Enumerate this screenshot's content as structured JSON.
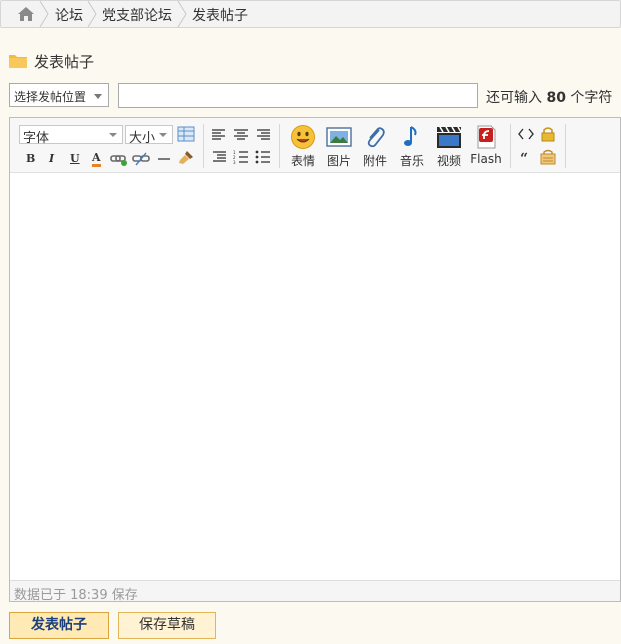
{
  "breadcrumb": {
    "items": [
      "论坛",
      "党支部论坛",
      "发表帖子"
    ]
  },
  "page": {
    "title": "发表帖子"
  },
  "form": {
    "position_select": "选择发帖位置",
    "subject_value": "",
    "limit_prefix": "还可输入",
    "limit_count": "80",
    "limit_suffix": "个字符"
  },
  "toolbar": {
    "font_select": "字体",
    "size_select": "大小",
    "format_buttons": [
      "B",
      "I",
      "U",
      "A"
    ],
    "media_buttons": [
      {
        "label": "表情",
        "icon": "smiley-icon"
      },
      {
        "label": "图片",
        "icon": "image-icon"
      },
      {
        "label": "附件",
        "icon": "paperclip-icon"
      },
      {
        "label": "音乐",
        "icon": "music-note-icon"
      },
      {
        "label": "视频",
        "icon": "clapperboard-icon"
      },
      {
        "label": "Flash",
        "icon": "flash-icon"
      }
    ]
  },
  "editor": {
    "content": "",
    "status": "数据已于 18:39 保存"
  },
  "actions": {
    "submit": "发表帖子",
    "save_draft": "保存草稿"
  },
  "colors": {
    "accent_button": "#ffe9b5",
    "button_text": "#1a3f7a",
    "page_bg": "#fcf9f0"
  }
}
